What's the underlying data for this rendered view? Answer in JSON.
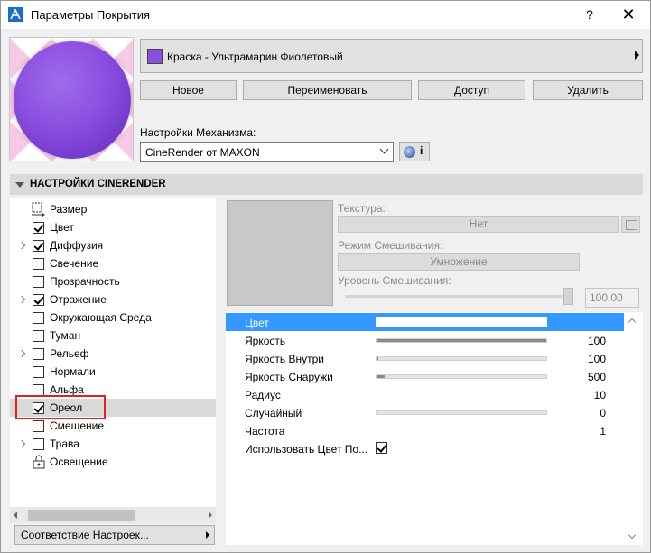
{
  "window": {
    "title": "Параметры Покрытия",
    "help_label": "?",
    "close_label": "✕"
  },
  "material": {
    "name": "Краска - Ультрамарин Фиолетовый",
    "swatch_color": "#8b4fe0"
  },
  "buttons": {
    "new": "Новое",
    "rename": "Переименовать",
    "access": "Доступ",
    "delete": "Удалить"
  },
  "engine": {
    "label": "Настройки Механизма:",
    "selected": "CineRender от MAXON",
    "info_label": "i"
  },
  "section": {
    "title": "НАСТРОЙКИ CINERENDER"
  },
  "channels": [
    {
      "label": "Размер",
      "kind": "size",
      "checked": false,
      "expandable": false,
      "selected": false
    },
    {
      "label": "Цвет",
      "kind": "checkbox",
      "checked": true,
      "expandable": false,
      "selected": false
    },
    {
      "label": "Диффузия",
      "kind": "checkbox",
      "checked": true,
      "expandable": true,
      "selected": false
    },
    {
      "label": "Свечение",
      "kind": "checkbox",
      "checked": false,
      "expandable": false,
      "selected": false
    },
    {
      "label": "Прозрачность",
      "kind": "checkbox",
      "checked": false,
      "expandable": false,
      "selected": false
    },
    {
      "label": "Отражение",
      "kind": "checkbox",
      "checked": true,
      "expandable": true,
      "selected": false
    },
    {
      "label": "Окружающая Среда",
      "kind": "checkbox",
      "checked": false,
      "expandable": false,
      "selected": false
    },
    {
      "label": "Туман",
      "kind": "checkbox",
      "checked": false,
      "expandable": false,
      "selected": false
    },
    {
      "label": "Рельеф",
      "kind": "checkbox",
      "checked": false,
      "expandable": true,
      "selected": false
    },
    {
      "label": "Нормали",
      "kind": "checkbox",
      "checked": false,
      "expandable": false,
      "selected": false
    },
    {
      "label": "Альфа",
      "kind": "checkbox",
      "checked": false,
      "expandable": false,
      "selected": false
    },
    {
      "label": "Ореол",
      "kind": "checkbox",
      "checked": true,
      "expandable": false,
      "selected": true
    },
    {
      "label": "Смещение",
      "kind": "checkbox",
      "checked": false,
      "expandable": false,
      "selected": false
    },
    {
      "label": "Трава",
      "kind": "checkbox",
      "checked": false,
      "expandable": true,
      "selected": false
    },
    {
      "label": "Освещение",
      "kind": "lock",
      "checked": false,
      "expandable": false,
      "selected": false
    }
  ],
  "match_settings": {
    "label": "Соответствие Настроек..."
  },
  "texture": {
    "texture_label": "Текстура:",
    "texture_value": "Нет",
    "blend_mode_label": "Режим Смешивания:",
    "blend_mode_value": "Умножение",
    "blend_level_label": "Уровень Смешивания:",
    "blend_level_value": "100,00"
  },
  "params": [
    {
      "name": "Цвет",
      "kind": "color",
      "selected": true,
      "color": "#ffffff"
    },
    {
      "name": "Яркость",
      "kind": "bar",
      "value": "100",
      "fraction": 1.0,
      "selected": false
    },
    {
      "name": "Яркость Внутри",
      "kind": "bar",
      "value": "100",
      "fraction": 0.01,
      "selected": false
    },
    {
      "name": "Яркость Снаружи",
      "kind": "bar",
      "value": "500",
      "fraction": 0.05,
      "selected": false
    },
    {
      "name": "Радиус",
      "kind": "number",
      "value": "10",
      "selected": false
    },
    {
      "name": "Случайный",
      "kind": "bar",
      "value": "0",
      "fraction": 0.0,
      "selected": false
    },
    {
      "name": "Частота",
      "kind": "number",
      "value": "1",
      "selected": false
    },
    {
      "name": "Использовать Цвет По...",
      "kind": "checkbox",
      "checked": true,
      "selected": false
    }
  ]
}
